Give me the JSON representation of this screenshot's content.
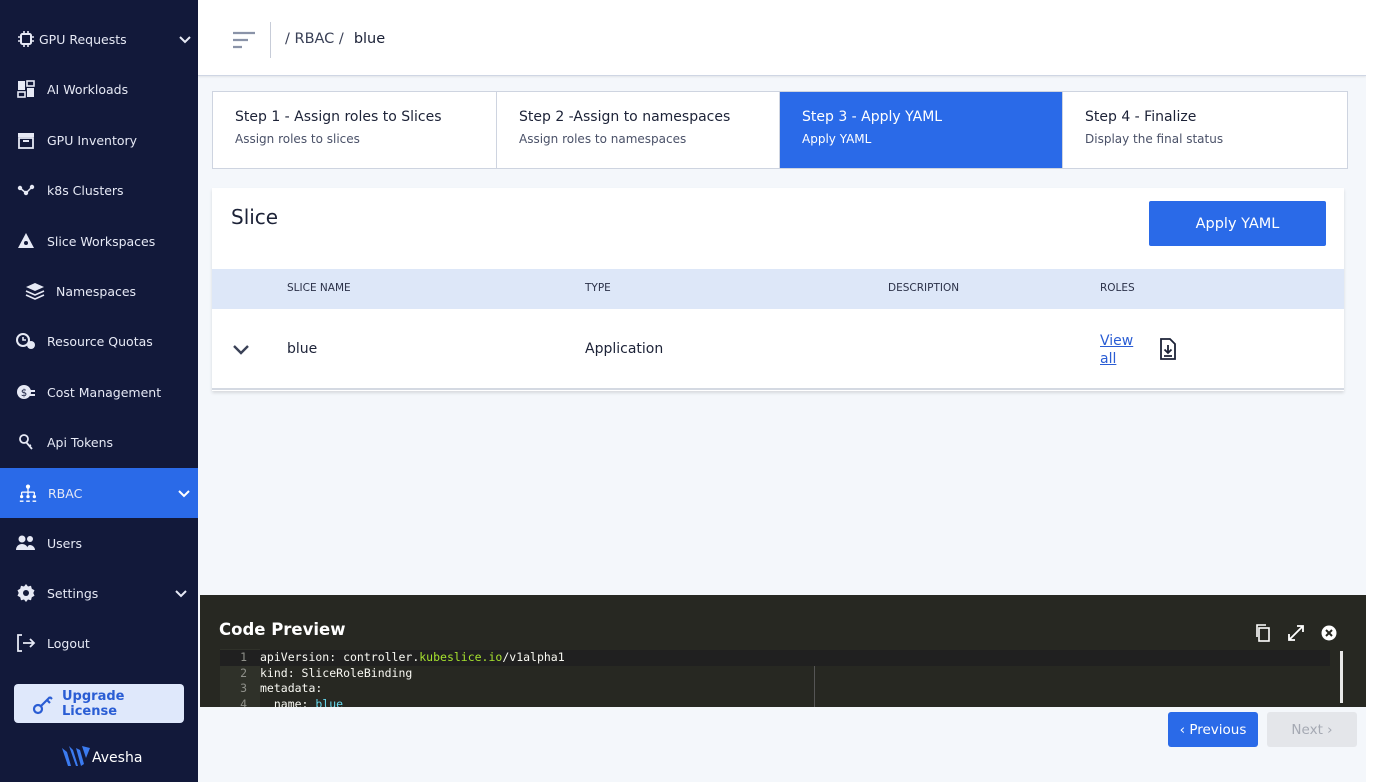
{
  "sidebar": {
    "items": [
      {
        "label": "GPU Requests",
        "icon": "chip-icon"
      },
      {
        "label": "AI Workloads",
        "icon": "dashboard-icon"
      },
      {
        "label": "GPU Inventory",
        "icon": "inventory-icon"
      },
      {
        "label": "k8s Clusters",
        "icon": "cluster-icon"
      },
      {
        "label": "Slice Workspaces",
        "icon": "slice-icon"
      },
      {
        "label": "Namespaces",
        "icon": "layers-icon"
      },
      {
        "label": "Resource Quotas",
        "icon": "quota-icon"
      },
      {
        "label": "Cost Management",
        "icon": "cost-icon"
      },
      {
        "label": "Api Tokens",
        "icon": "key-icon"
      },
      {
        "label": "RBAC",
        "icon": "rbac-icon"
      },
      {
        "label": "Users",
        "icon": "users-icon"
      },
      {
        "label": "Settings",
        "icon": "gear-icon"
      },
      {
        "label": "Logout",
        "icon": "logout-icon"
      }
    ],
    "upgrade_label": "Upgrade License",
    "brand": "Avesha"
  },
  "header": {
    "breadcrumb_root": "/ RBAC /",
    "breadcrumb_current": "blue"
  },
  "stepper": {
    "steps": [
      {
        "title": "Step 1 - Assign roles to Slices",
        "subtitle": "Assign roles to slices"
      },
      {
        "title": "Step 2 -Assign to namespaces",
        "subtitle": "Assign roles to namespaces"
      },
      {
        "title": "Step 3 - Apply YAML",
        "subtitle": "Apply YAML"
      },
      {
        "title": "Step 4 - Finalize",
        "subtitle": "Display the final status"
      }
    ]
  },
  "slice_card": {
    "title": "Slice",
    "apply_label": "Apply YAML",
    "columns": [
      "SLICE NAME",
      "TYPE",
      "DESCRIPTION",
      "ROLES"
    ],
    "rows": [
      {
        "name": "blue",
        "type": "Application",
        "description": "",
        "roles_link": "View all"
      }
    ]
  },
  "code_preview": {
    "title": "Code Preview",
    "lines": [
      {
        "n": "1",
        "key": "apiVersion: controller.",
        "hl": "kubeslice.io",
        "rest": "/v1alpha1"
      },
      {
        "n": "2",
        "key": "kind: SliceRoleBinding",
        "hl": "",
        "rest": ""
      },
      {
        "n": "3",
        "key": "metadata:",
        "hl": "",
        "rest": ""
      },
      {
        "n": "4",
        "key": "  name: ",
        "hl": "blue",
        "rest": ""
      }
    ]
  },
  "footer": {
    "previous_label": "Previous",
    "next_label": "Next"
  },
  "colors": {
    "sidebar_bg": "#12193a",
    "accent": "#2a6ae8",
    "code_bg": "#272822"
  }
}
